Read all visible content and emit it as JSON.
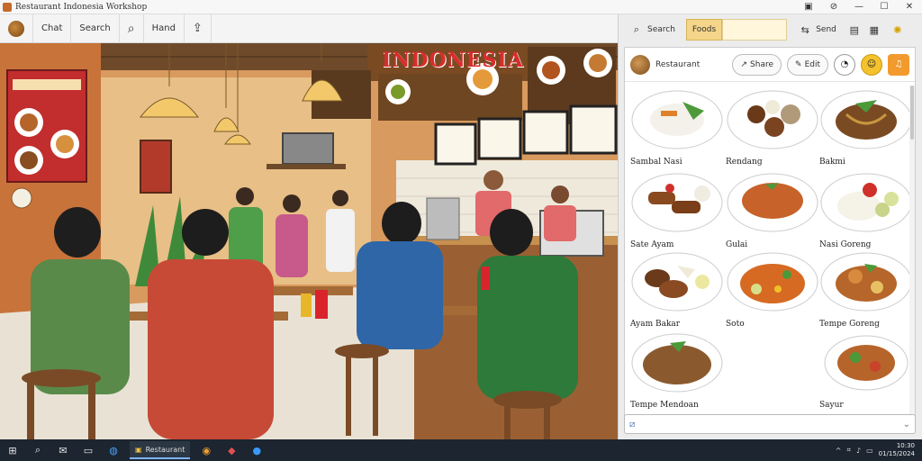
{
  "window": {
    "title": "Restaurant Indonesia Workshop",
    "controls": [
      "minimize",
      "restore",
      "close"
    ]
  },
  "toolbar": {
    "items": [
      {
        "label": "",
        "icon": "food-icon"
      },
      {
        "label": "Chat",
        "icon": "chat-icon"
      },
      {
        "label": "Search",
        "icon": ""
      },
      {
        "label": "",
        "icon": "search-icon"
      },
      {
        "label": "Hand",
        "icon": ""
      },
      {
        "label": "",
        "icon": "share-icon"
      }
    ]
  },
  "scene": {
    "sign_text": "INDONESIA"
  },
  "panel": {
    "tabs": [
      {
        "label": "Search",
        "icon": "search-icon",
        "active": false
      },
      {
        "label": "Foods",
        "icon": "",
        "active": true
      }
    ],
    "actions": [
      {
        "label": "Send",
        "icon": "send-icon"
      }
    ],
    "card": {
      "header_label": "Restaurant",
      "buttons": [
        {
          "label": "Share",
          "icon": "share-icon"
        },
        {
          "label": "Edit",
          "icon": "edit-icon"
        }
      ],
      "foods": [
        {
          "name": "Sambal Nasi",
          "kind": "rice"
        },
        {
          "name": "Rendang",
          "kind": "meat"
        },
        {
          "name": "Bakmi",
          "kind": "noodle"
        },
        {
          "name": "Sate Ayam",
          "kind": "skewer"
        },
        {
          "name": "Gulai",
          "kind": "curry"
        },
        {
          "name": "Nasi Goreng",
          "kind": "rice"
        },
        {
          "name": "Ayam Bakar",
          "kind": "meat"
        },
        {
          "name": "Soto",
          "kind": "stew"
        },
        {
          "name": "Tempe Goreng",
          "kind": "curry"
        },
        {
          "name": "Tempe Mendoan",
          "kind": "tempe"
        },
        {
          "name": "Sayur",
          "kind": "stew"
        }
      ]
    },
    "search_placeholder": ""
  },
  "taskbar": {
    "active_app": "Restaurant",
    "time": "10:30",
    "date": "01/15/2024"
  },
  "colors": {
    "accent_tab": "#f4d58a",
    "wall": "#c8753a",
    "taskbar": "#1c2530"
  }
}
